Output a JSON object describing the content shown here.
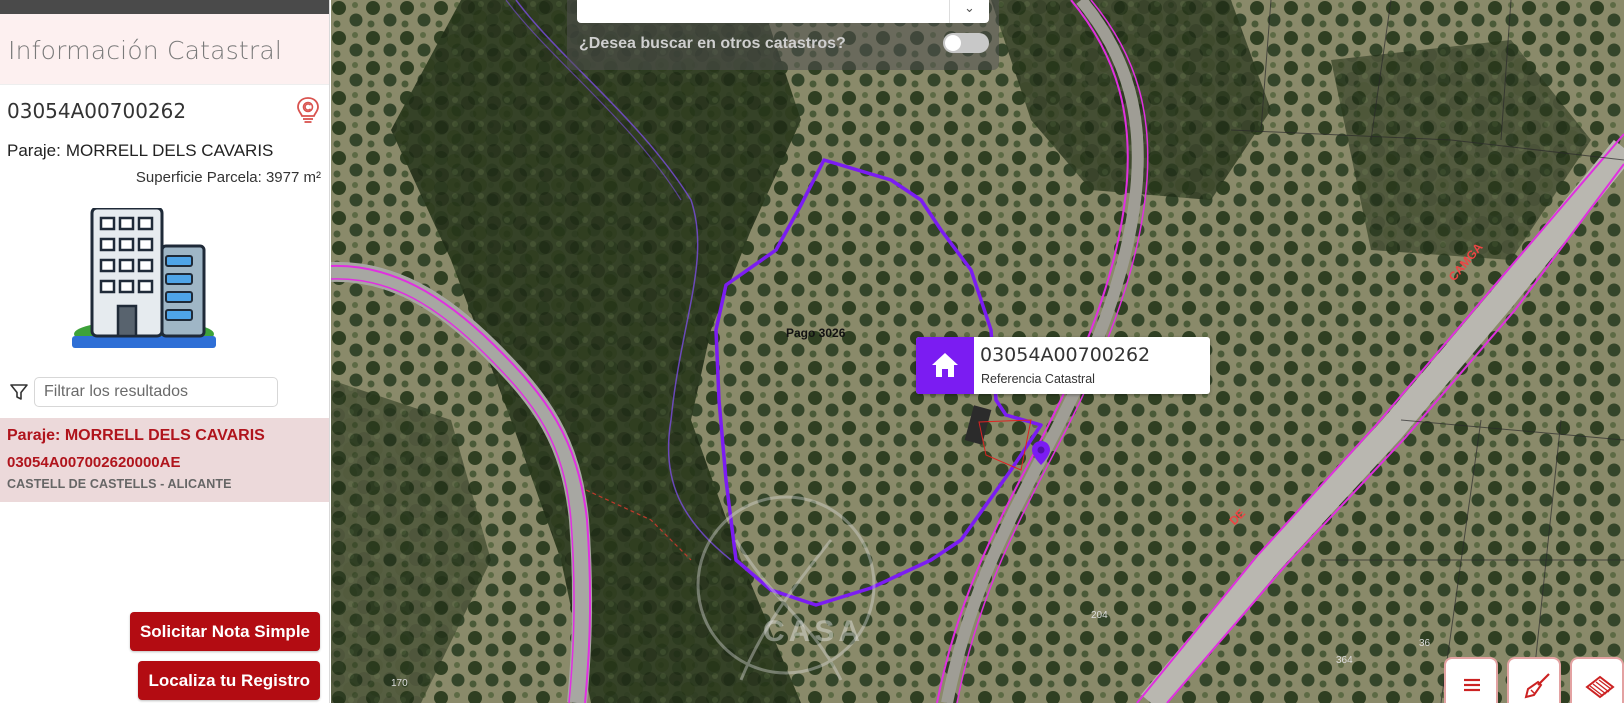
{
  "sidebar": {
    "title": "Información Catastral",
    "reference": "03054A00700262",
    "paraje_label": "Paraje:",
    "paraje_value": "MORRELL DELS CAVARIS",
    "superficie": "Superficie Parcela: 3977 m²",
    "filter_placeholder": "Filtrar los resultados",
    "result": {
      "paraje": "Paraje: MORRELL DELS CAVARIS",
      "reference": "03054A007002620000AE",
      "location": "CASTELL DE CASTELLS - ALICANTE"
    },
    "buttons": {
      "nota_simple": "Solicitar Nota Simple",
      "localiza": "Localiza tu Registro"
    }
  },
  "map": {
    "search_question": "¿Desea buscar en otros catastros?",
    "search_toggle_on": false,
    "popup": {
      "reference": "03054A00700262",
      "label": "Referencia Catastral"
    },
    "labels": {
      "parcel": "Pago 3026",
      "road_top": "CAMGA",
      "road_mid": "DE",
      "height_a": "170",
      "height_b": "204",
      "height_c": "364",
      "height_d": "36"
    },
    "watermark": "CASA"
  },
  "colors": {
    "accent_red": "#b30c12",
    "parcel_purple": "#7b1cf2",
    "boundary_magenta": "#e030e0",
    "result_bg": "#ecd9da"
  },
  "icons": {
    "bulb": "lightbulb-copyright-icon",
    "building": "building-icon",
    "filter": "filter-funnel-icon",
    "home": "home-icon",
    "marker": "map-pin-icon",
    "menu": "menu-icon",
    "broom": "broom-icon",
    "layers": "cadastre-layer-icon"
  }
}
